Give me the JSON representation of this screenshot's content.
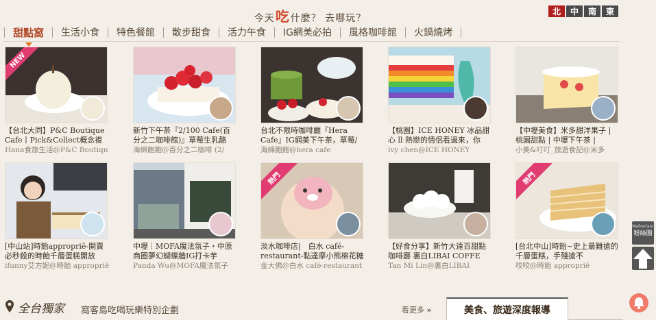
{
  "header": {
    "slogan_pre": "今天",
    "slogan_big": "吃",
    "slogan_post": "什麼？ 去哪玩？"
  },
  "regions": [
    "北",
    "中",
    "南",
    "東"
  ],
  "tabs": [
    "甜點窩",
    "生活小食",
    "特色餐館",
    "散步甜食",
    "活力午食",
    "IG網美必拍",
    "風格咖啡館",
    "火鍋燒烤"
  ],
  "cards": [
    {
      "title": "【台北大同】P&C Boutique Cafe丨Pick&Collect概念複合",
      "author": "Hana食旅生活@P&C Boutiqu",
      "badge": "NEW"
    },
    {
      "title": "新竹下午茶『2/100 Cafe(百分之二咖啡館)』草莓生乳酪",
      "author": "海綿飽飽@百分之二咖啡 (2/",
      "badge": ""
    },
    {
      "title": "台北不限時咖啡廳『Hera Cafe』IG網美下午茶，草莓/抹",
      "author": "海綿飽飽@hera cafe",
      "badge": ""
    },
    {
      "title": "【桃園】ICE HONEY 冰品甜心 ll 熱戀的情侶看過來，你",
      "author": "ivy chen@ICE HONEY",
      "badge": ""
    },
    {
      "title": "【中壢美食】米多甜洋果子 | 桃園甜點 | 中壢下午茶 |",
      "author": "小美&叮叮_旅遊食記@米多",
      "badge": ""
    },
    {
      "title": "[中山站]時飴appropriē-開賣必秒殺的時飴千層蛋糕開放",
      "author": "ifunny艾方妮@時飴 appropriē",
      "badge": ""
    },
    {
      "title": "中壢｜MOFA魔法氛子・中原商圈夢幻蝴蝶牆IG打卡芋",
      "author": "Panda Wu@MOFA魔法氛子",
      "badge": ""
    },
    {
      "title": "淡水咖啡店|　白水 café-restaurant-黏達摩小熊棉花糖咖啡",
      "author": "金大佛@白水 café-restaurant",
      "badge": "熱門"
    },
    {
      "title": "【好食分享】新竹大遠百甜點咖啡廳 裏白LIBAI COFFE",
      "author": "Tan Mi Lin@裏白LIBAI",
      "badge": ""
    },
    {
      "title": "[台北中山]時飴~史上最難搶的千層蛋糕，手殘搶不",
      "author": "咬咬@時飴 appropriē",
      "badge": "熱門"
    }
  ],
  "bottom": {
    "exclusive_title": "全台獨家",
    "exclusive_sub": "窩客島吃喝玩樂特別企劃",
    "more_label": "看更多",
    "report_tab": "美食、旅遊深度報導"
  },
  "widgets": {
    "fans_top": "Walkerland",
    "fans_label": "粉絲團"
  },
  "colors": {
    "accent": "#b24a2a",
    "region_active": "#b01e1e",
    "badge": "#e13c72"
  }
}
